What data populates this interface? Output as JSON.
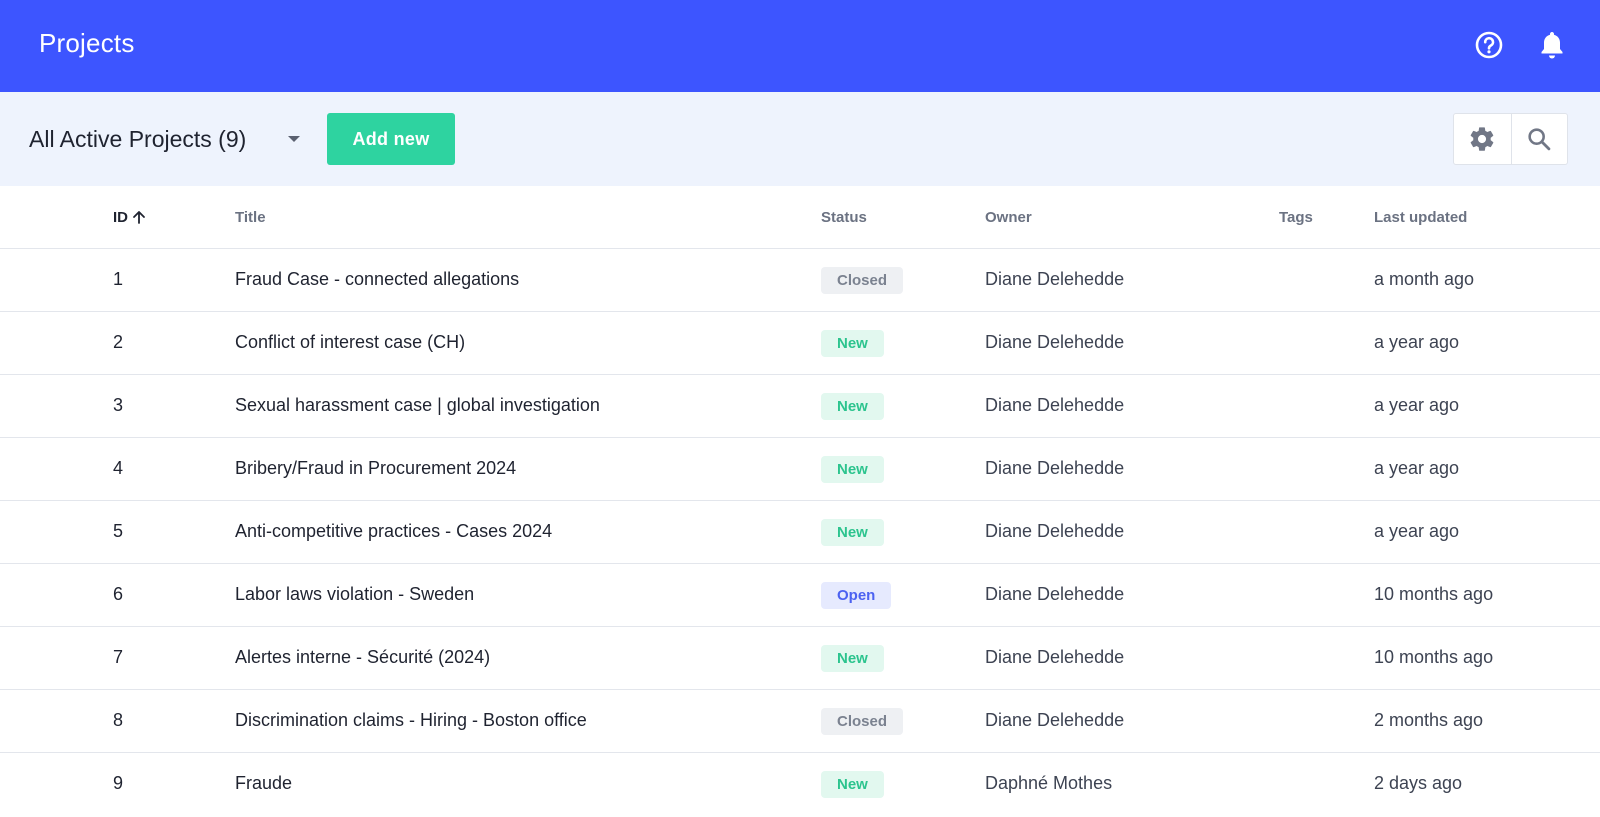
{
  "header": {
    "title": "Projects",
    "help_icon": "help-circle-icon",
    "notifications_icon": "bell-icon"
  },
  "toolbar": {
    "view_label": "All Active Projects (9)",
    "add_button": "Add new",
    "settings_icon": "gear-icon",
    "search_icon": "search-icon"
  },
  "table": {
    "columns": {
      "id": "ID",
      "title": "Title",
      "status": "Status",
      "owner": "Owner",
      "tags": "Tags",
      "last_updated": "Last updated"
    },
    "sort": {
      "column": "id",
      "direction": "ascending"
    },
    "rows": [
      {
        "id": "1",
        "title": "Fraud Case - connected allegations",
        "status": "Closed",
        "status_type": "closed",
        "owner": "Diane Delehedde",
        "tags": "",
        "last_updated": "a month ago"
      },
      {
        "id": "2",
        "title": "Conflict of interest case (CH)",
        "status": "New",
        "status_type": "new",
        "owner": "Diane Delehedde",
        "tags": "",
        "last_updated": "a year ago"
      },
      {
        "id": "3",
        "title": "Sexual harassment case | global investigation",
        "status": "New",
        "status_type": "new",
        "owner": "Diane Delehedde",
        "tags": "",
        "last_updated": "a year ago"
      },
      {
        "id": "4",
        "title": "Bribery/Fraud in Procurement 2024",
        "status": "New",
        "status_type": "new",
        "owner": "Diane Delehedde",
        "tags": "",
        "last_updated": "a year ago"
      },
      {
        "id": "5",
        "title": "Anti-competitive practices - Cases 2024",
        "status": "New",
        "status_type": "new",
        "owner": "Diane Delehedde",
        "tags": "",
        "last_updated": "a year ago"
      },
      {
        "id": "6",
        "title": "Labor laws violation - Sweden",
        "status": "Open",
        "status_type": "open",
        "owner": "Diane Delehedde",
        "tags": "",
        "last_updated": "10 months ago"
      },
      {
        "id": "7",
        "title": "Alertes interne - Sécurité (2024)",
        "status": "New",
        "status_type": "new",
        "owner": "Diane Delehedde",
        "tags": "",
        "last_updated": "10 months ago"
      },
      {
        "id": "8",
        "title": "Discrimination claims - Hiring - Boston office",
        "status": "Closed",
        "status_type": "closed",
        "owner": "Diane Delehedde",
        "tags": "",
        "last_updated": "2 months ago"
      },
      {
        "id": "9",
        "title": "Fraude",
        "status": "New",
        "status_type": "new",
        "owner": "Daphné Mothes",
        "tags": "",
        "last_updated": "2 days ago"
      }
    ]
  },
  "colors": {
    "header_bg": "#3d55ff",
    "toolbar_bg": "#eef3fd",
    "accent_green": "#2ed3a0",
    "status_new": "#2cc48e",
    "status_open": "#4c62f1",
    "status_closed": "#7b8290"
  }
}
